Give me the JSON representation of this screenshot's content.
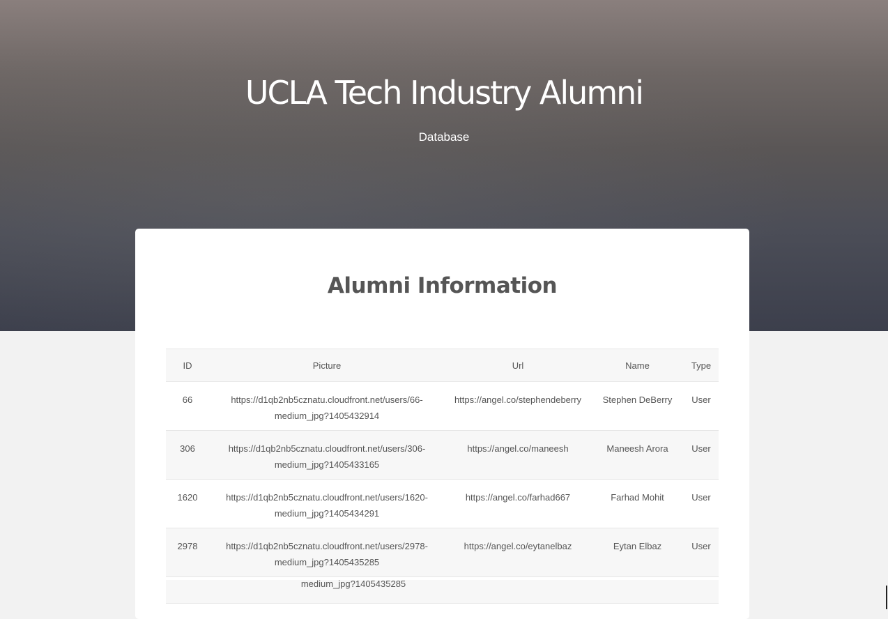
{
  "hero": {
    "title": "UCLA Tech Industry Alumni",
    "subtitle": "Database"
  },
  "card": {
    "title": "Alumni Information"
  },
  "table": {
    "headers": [
      "ID",
      "Picture",
      "Url",
      "Name",
      "Type"
    ],
    "rows": [
      {
        "id": "66",
        "picture_line1": "https://d1qb2nb5cznatu.cloudfront.net/users/66-",
        "picture_line2": "medium_jpg?1405432914",
        "url": "https://angel.co/stephendeberry",
        "name": "Stephen DeBerry",
        "type": "User"
      },
      {
        "id": "306",
        "picture_line1": "https://d1qb2nb5cznatu.cloudfront.net/users/306-",
        "picture_line2": "medium_jpg?1405433165",
        "url": "https://angel.co/maneesh",
        "name": "Maneesh Arora",
        "type": "User"
      },
      {
        "id": "1620",
        "picture_line1": "https://d1qb2nb5cznatu.cloudfront.net/users/1620-",
        "picture_line2": "medium_jpg?1405434291",
        "url": "https://angel.co/farhad667",
        "name": "Farhad Mohit",
        "type": "User"
      },
      {
        "id": "2978",
        "picture_line1": "https://d1qb2nb5cznatu.cloudfront.net/users/2978-",
        "picture_line2": "medium_jpg?1405435285",
        "url": "https://angel.co/eytanelbaz",
        "name": "Eytan Elbaz",
        "type": "User"
      }
    ],
    "partial_row_text": "medium_jpg?1405435285"
  }
}
